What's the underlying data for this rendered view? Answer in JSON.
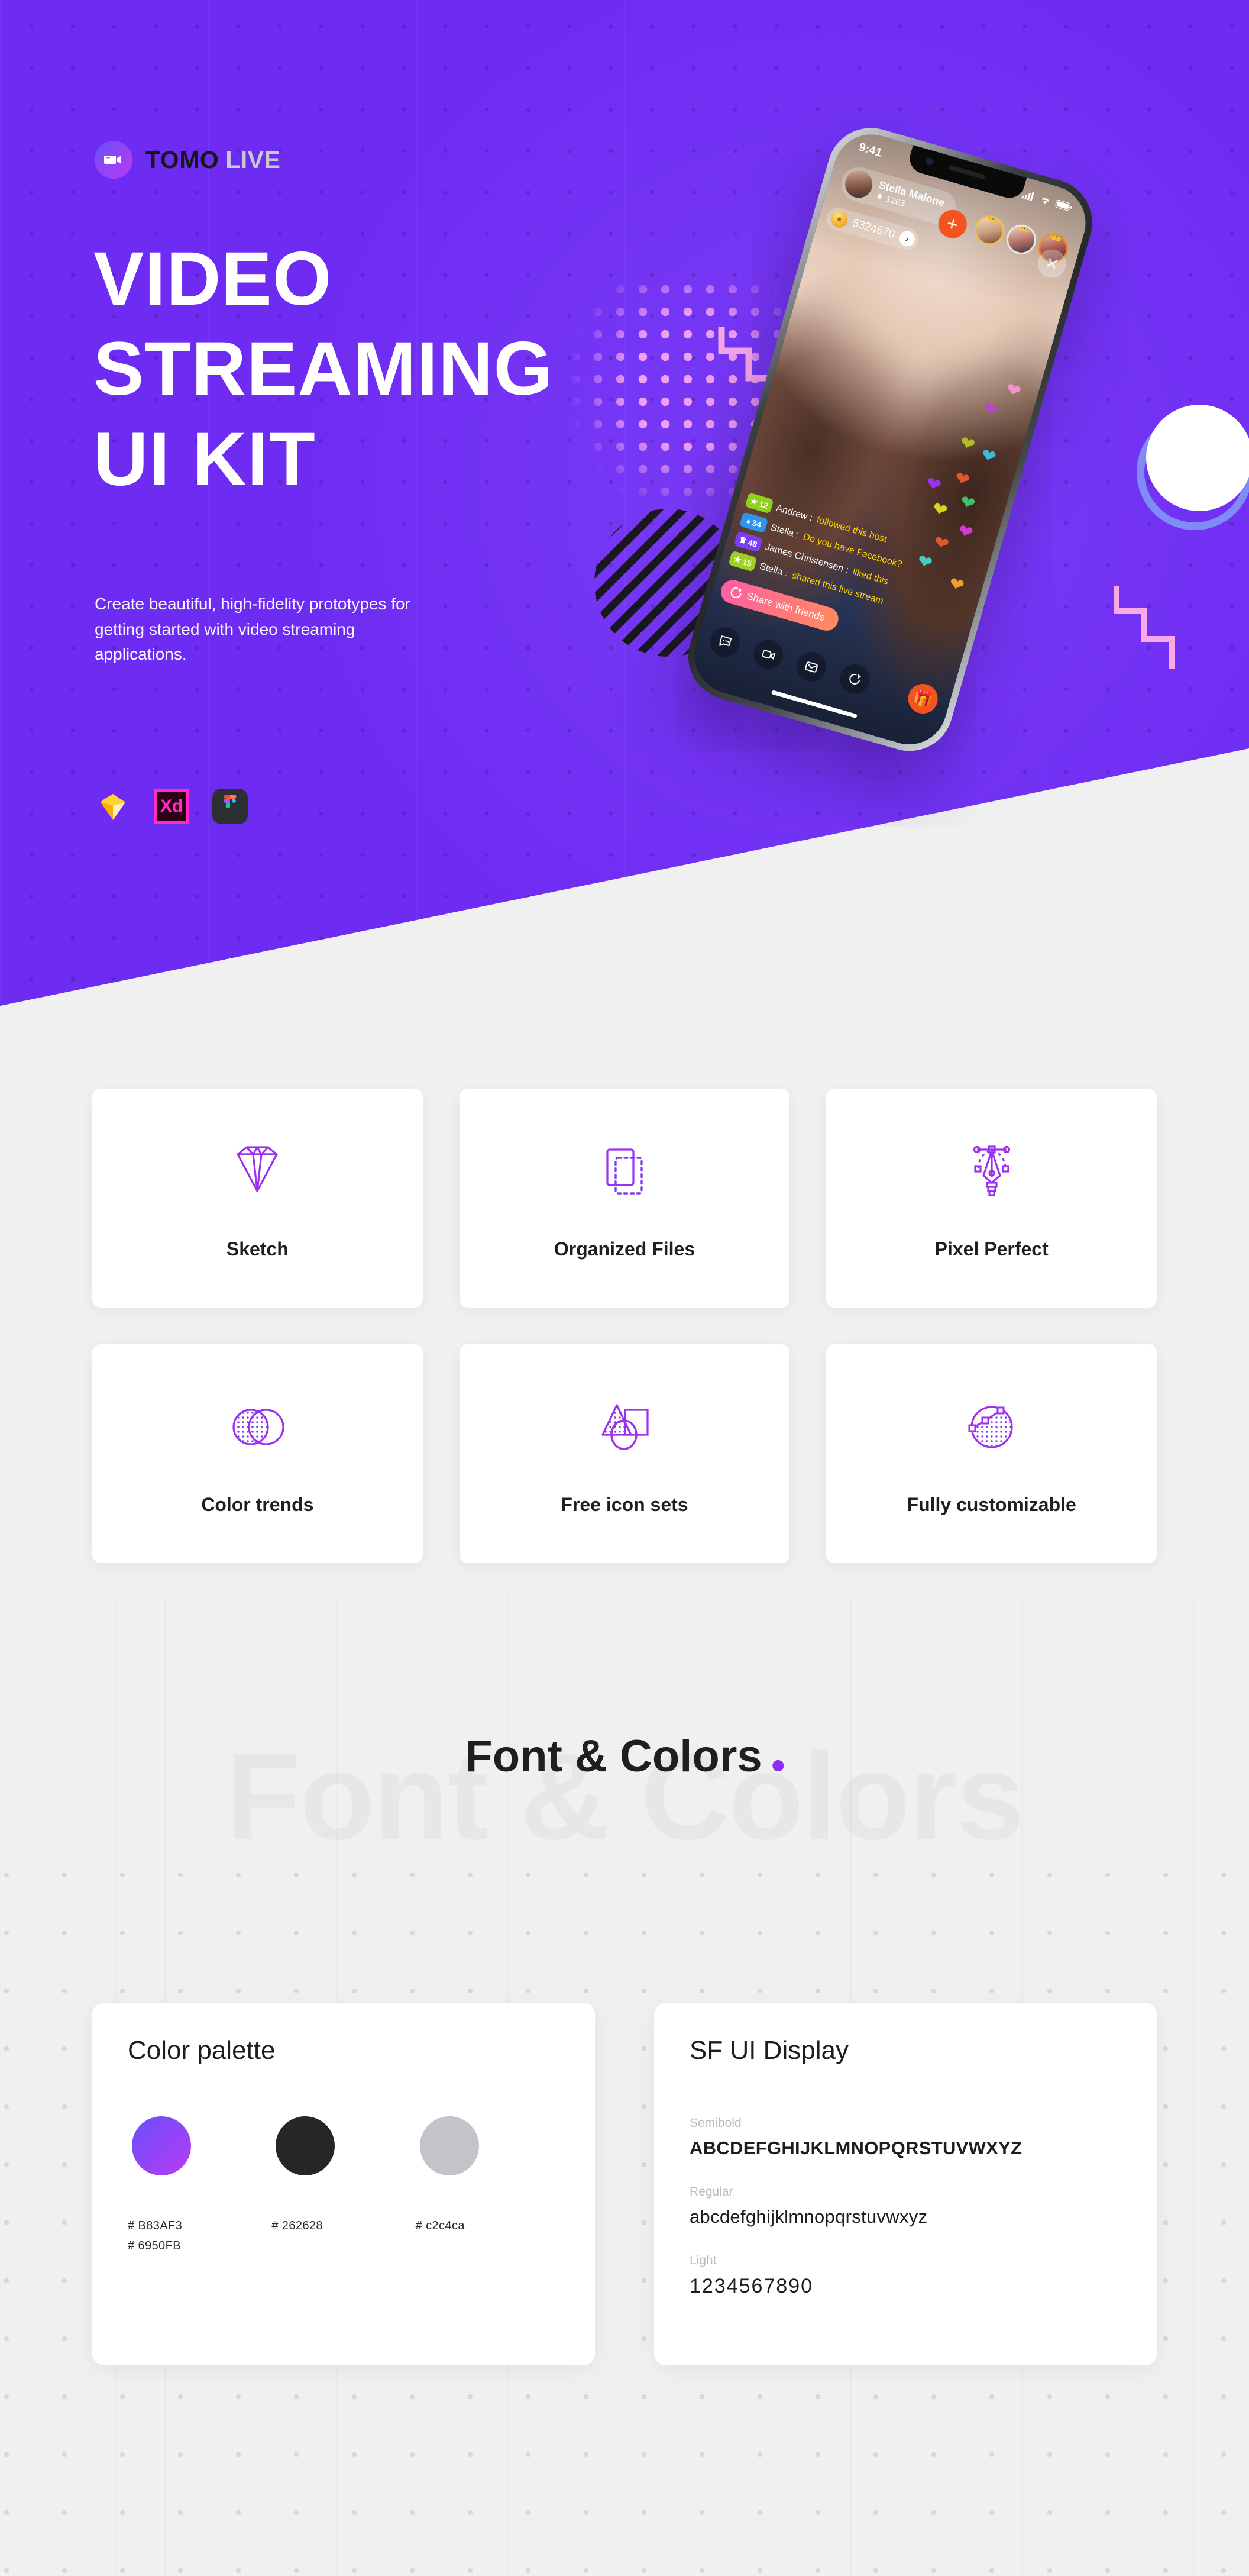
{
  "brand": {
    "logo_icon": "video-camera-icon",
    "name_primary": "TOMO",
    "name_secondary": "LIVE"
  },
  "hero": {
    "headline_line1": "VIDEO",
    "headline_line2": "STREAMING",
    "headline_line3": "UI KIT",
    "subtitle": "Create beautiful, high-fidelity prototypes for getting started with video streaming applications.",
    "background_color": "#6E2CF2",
    "tools": [
      {
        "name": "sketch-icon",
        "label": "Sketch"
      },
      {
        "name": "adobe-xd-icon",
        "label": "Xd"
      },
      {
        "name": "figma-icon",
        "label": "Figma"
      }
    ]
  },
  "phone": {
    "status": {
      "time": "9:41",
      "signal": "signal-icon",
      "wifi": "wifi-icon",
      "battery": "battery-icon"
    },
    "host": {
      "name": "Stella Malone",
      "viewer_count": "1263",
      "viewer_icon": "flame-icon"
    },
    "coins": {
      "value": "5324670",
      "icon": "coin-icon",
      "arrow": "chevron-right-icon"
    },
    "add_button": "+",
    "close_button": "✕",
    "viewers": [
      {
        "crown": "👑"
      },
      {
        "crown": "👑"
      },
      {
        "crown": "👑"
      }
    ],
    "chat": [
      {
        "level": "12",
        "user": "Andrew",
        "message": "followed this host"
      },
      {
        "level": "34",
        "user": "Stella",
        "message": "Do you have Facebook?"
      },
      {
        "level": "48",
        "user": "James Christensen",
        "message": "liked this"
      },
      {
        "level": "15",
        "user": "Stella",
        "message": "shared this live stream"
      }
    ],
    "share_button": "Share with friends",
    "toolbar": [
      {
        "name": "chat-bubble-icon"
      },
      {
        "name": "video-camera-icon"
      },
      {
        "name": "message-envelope-icon"
      },
      {
        "name": "share-icon"
      },
      {
        "name": "gift-icon"
      }
    ],
    "hearts": [
      "❤",
      "❤",
      "❤",
      "❤",
      "❤",
      "❤",
      "❤",
      "❤",
      "❤",
      "❤",
      "❤",
      "❤"
    ]
  },
  "features": [
    {
      "icon": "diamond-icon",
      "label": "Sketch"
    },
    {
      "icon": "layers-files-icon",
      "label": "Organized Files"
    },
    {
      "icon": "pen-tool-icon",
      "label": "Pixel Perfect"
    },
    {
      "icon": "overlapping-circles-icon",
      "label": "Color trends"
    },
    {
      "icon": "shapes-icon",
      "label": "Free icon sets"
    },
    {
      "icon": "customizable-circle-icon",
      "label": "Fully customizable"
    }
  ],
  "font_colors": {
    "section_title": "Font & Colors",
    "ghost_text": "Font & Colors",
    "accent_dot_color": "#8f2bf5",
    "palette": {
      "title": "Color palette",
      "swatches": [
        {
          "type": "gradient",
          "hex_lines": [
            "# B83AF3",
            "# 6950FB"
          ],
          "from": "#6950FB",
          "to": "#B83AF3"
        },
        {
          "type": "solid",
          "hex_lines": [
            "# 262628"
          ],
          "color": "#262628"
        },
        {
          "type": "solid",
          "hex_lines": [
            "# c2c4ca"
          ],
          "color": "#c2c4ca"
        }
      ]
    },
    "typography": {
      "title": "SF UI Display",
      "blocks": [
        {
          "weight": "Semibold",
          "sample": "ABCDEFGHIJKLMNOPQRSTUVWXYZ"
        },
        {
          "weight": "Regular",
          "sample": "abcdefghijklmnopqrstuvwxyz"
        },
        {
          "weight": "Light",
          "sample": "1234567890"
        }
      ]
    }
  }
}
